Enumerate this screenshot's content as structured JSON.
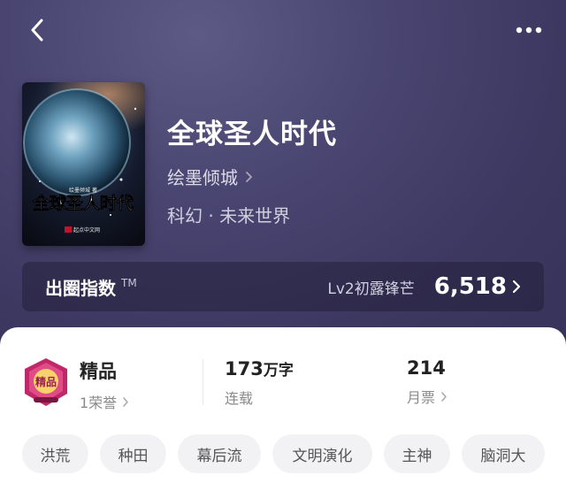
{
  "colors": {
    "hero_bg": "#46426e",
    "accent_badge": "#c0286a",
    "tag_bg": "#f2f2f4"
  },
  "nav": {
    "back_icon": "chevron-left-icon",
    "more_icon": "more-dots-icon"
  },
  "book": {
    "title": "全球圣人时代",
    "author": "绘墨倾城",
    "genre": "科幻 · 未来世界",
    "cover": {
      "author_line": "绘墨倾城 著",
      "title": "全球圣人时代",
      "publisher": "起点中文网"
    }
  },
  "index": {
    "label": "出圈指数",
    "tm": "TM",
    "level": "Lv2初露锋芒",
    "score": "6,518"
  },
  "stats": {
    "honor": {
      "badge_text": "精品",
      "title": "精品",
      "sub": "1荣誉"
    },
    "words": {
      "number": "173",
      "unit": "万字",
      "sub": "连载"
    },
    "votes": {
      "number": "214",
      "sub": "月票"
    }
  },
  "tags": [
    "洪荒",
    "种田",
    "幕后流",
    "文明演化",
    "主神",
    "脑洞大"
  ]
}
